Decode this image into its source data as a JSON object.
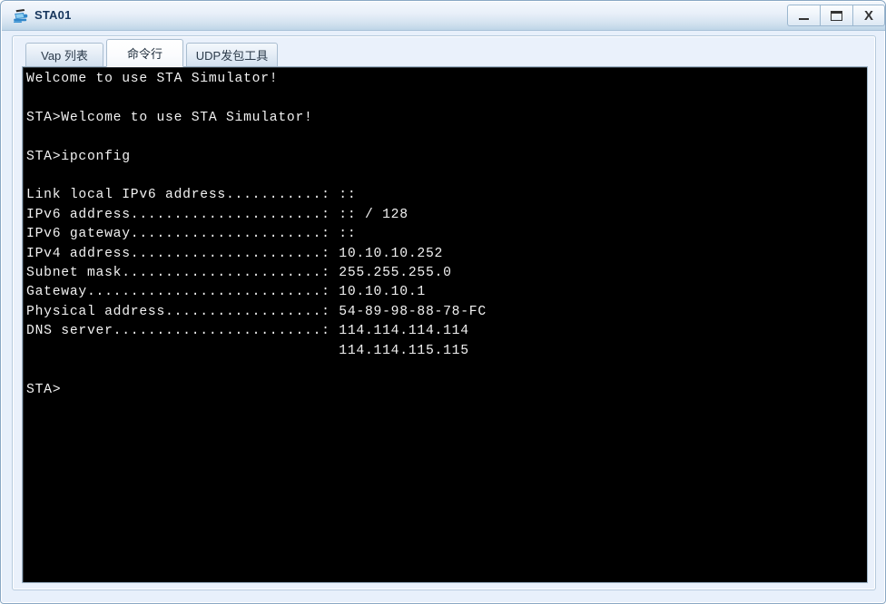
{
  "window": {
    "title": "STA01",
    "icon": "sta-device-icon",
    "controls": {
      "minimize": "–",
      "maximize": "☐",
      "close": "X",
      "minimize_name": "minimize-button",
      "maximize_name": "maximize-button",
      "close_name": "close-button"
    }
  },
  "tabs": [
    {
      "label": "Vap 列表",
      "active": false
    },
    {
      "label": "命令行",
      "active": true
    },
    {
      "label": "UDP发包工具",
      "active": false
    }
  ],
  "console": {
    "prompt": "STA>",
    "lines": [
      "Welcome to use STA Simulator!",
      "",
      "STA>Welcome to use STA Simulator!",
      "",
      "STA>ipconfig",
      "",
      "Link local IPv6 address...........: ::",
      "IPv6 address......................: :: / 128",
      "IPv6 gateway......................: ::",
      "IPv4 address......................: 10.10.10.252",
      "Subnet mask.......................: 255.255.255.0",
      "Gateway...........................: 10.10.10.1",
      "Physical address..................: 54-89-98-88-78-FC",
      "DNS server........................: 114.114.114.114",
      "                                    114.114.115.115",
      "",
      "STA>"
    ],
    "text": "Welcome to use STA Simulator!\n\nSTA>Welcome to use STA Simulator!\n\nSTA>ipconfig\n\nLink local IPv6 address...........: ::\nIPv6 address......................: :: / 128\nIPv6 gateway......................: ::\nIPv4 address......................: 10.10.10.252\nSubnet mask.......................: 255.255.255.0\nGateway...........................: 10.10.10.1\nPhysical address..................: 54-89-98-88-78-FC\nDNS server........................: 114.114.114.114\n                                    114.114.115.115\n\nSTA>",
    "fields": {
      "link_local_ipv6_address": "::",
      "ipv6_address": ":: / 128",
      "ipv6_gateway": "::",
      "ipv4_address": "10.10.10.252",
      "subnet_mask": "255.255.255.0",
      "gateway": "10.10.10.1",
      "physical_address": "54-89-98-88-78-FC",
      "dns_server_primary": "114.114.114.114",
      "dns_server_secondary": "114.114.115.115"
    }
  },
  "colors": {
    "title_bar_top": "#f3f7fc",
    "title_bar_bottom": "#bed5e7",
    "panel_bg": "#eaf1fb",
    "console_bg": "#000000",
    "console_fg": "#f2f2f2",
    "border": "#a9c2d8",
    "title_text": "#17365d"
  }
}
